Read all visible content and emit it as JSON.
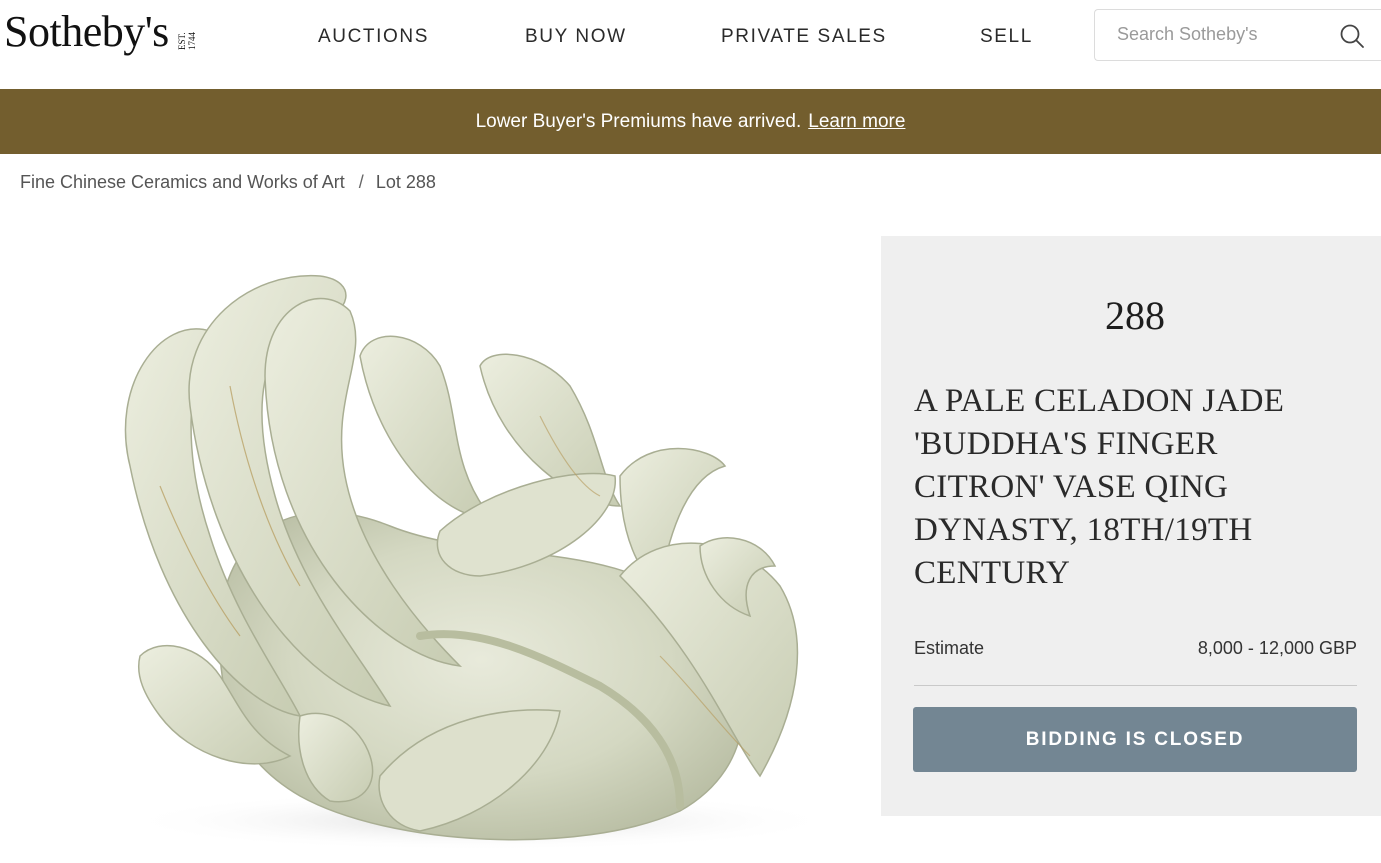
{
  "header": {
    "logo_text": "Sotheby's",
    "logo_est": "EST. 1744",
    "nav": [
      {
        "label": "AUCTIONS"
      },
      {
        "label": "BUY NOW"
      },
      {
        "label": "PRIVATE SALES"
      },
      {
        "label": "SELL"
      }
    ],
    "search": {
      "placeholder": "Search Sotheby's",
      "icon": "search-icon"
    }
  },
  "banner": {
    "text": "Lower Buyer's Premiums have arrived.",
    "link": "Learn more"
  },
  "breadcrumb": {
    "items": [
      "Fine Chinese Ceramics and Works of Art",
      "Lot 288"
    ],
    "separator": "/"
  },
  "lot": {
    "number": "288",
    "title": "A Pale Celadon Jade 'Buddha's Finger Citron' Vase Qing Dynasty, 18th/19th Century",
    "estimate_label": "Estimate",
    "estimate_value": "8,000 - 12,000 GBP",
    "button_label": "BIDDING IS CLOSED"
  },
  "colors": {
    "banner": "#735e2e",
    "button": "#738693",
    "panel": "#efefef",
    "jade": "#d9dcc6"
  }
}
